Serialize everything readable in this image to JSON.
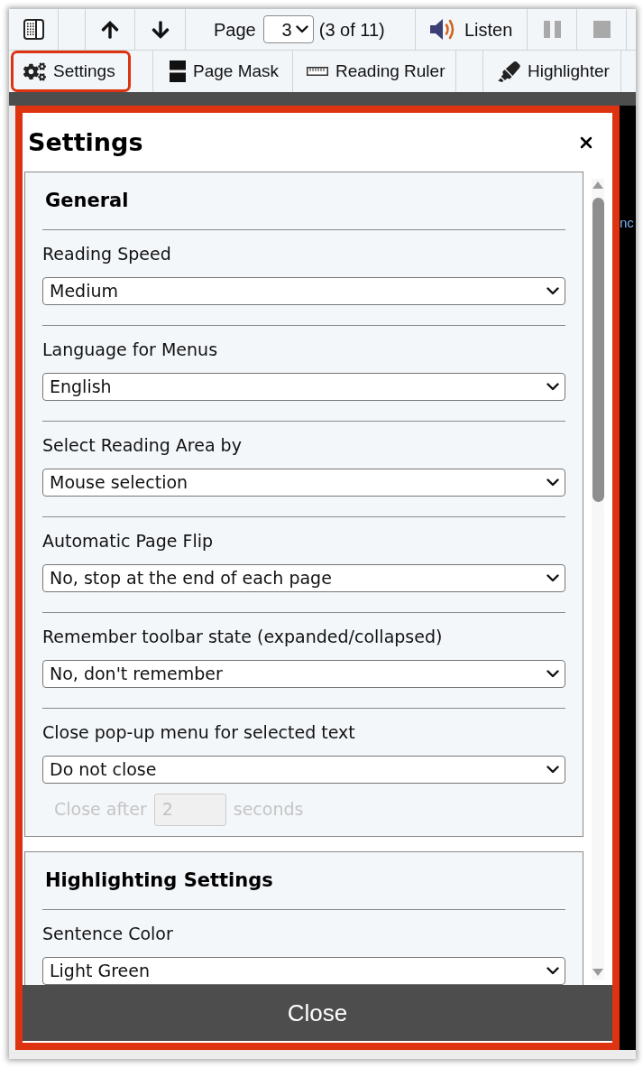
{
  "toolbar": {
    "page_label": "Page",
    "page_select": "3",
    "page_count": "(3 of 11)",
    "listen_button": "Listen",
    "pause_button": {
      "disabled": true
    },
    "stop_button": {
      "disabled": true
    },
    "tools": [
      {
        "kind": "settings",
        "label": "Settings",
        "highlighted": true
      },
      {
        "kind": "page_mask",
        "label": "Page Mask",
        "highlighted": false
      },
      {
        "kind": "reading_ruler",
        "label": "Reading Ruler",
        "highlighted": false
      },
      {
        "kind": "highlighter",
        "label": "Highlighter",
        "highlighted": false
      }
    ]
  },
  "background_text": "nc",
  "dialog": {
    "title": "Settings",
    "highlighted": true,
    "sections": [
      {
        "title": "General",
        "settings": [
          {
            "label": "Reading Speed",
            "value": "Medium"
          },
          {
            "label": "Language for Menus",
            "value": "English"
          },
          {
            "label": "Select Reading Area by",
            "value": "Mouse selection"
          },
          {
            "label": "Automatic Page Flip",
            "value": "No, stop at the end of each page"
          },
          {
            "label": "Remember toolbar state (expanded/collapsed)",
            "value": "No, don't remember"
          },
          {
            "label": "Close pop-up menu for selected text",
            "value": "Do not close",
            "delay": {
              "label": "Close after",
              "value": "2",
              "unit": "seconds",
              "disabled": true
            }
          }
        ]
      },
      {
        "title": "Highlighting Settings",
        "settings": [
          {
            "label": "Sentence Color",
            "value": "Light Green"
          }
        ]
      }
    ],
    "close_button": "Close"
  }
}
